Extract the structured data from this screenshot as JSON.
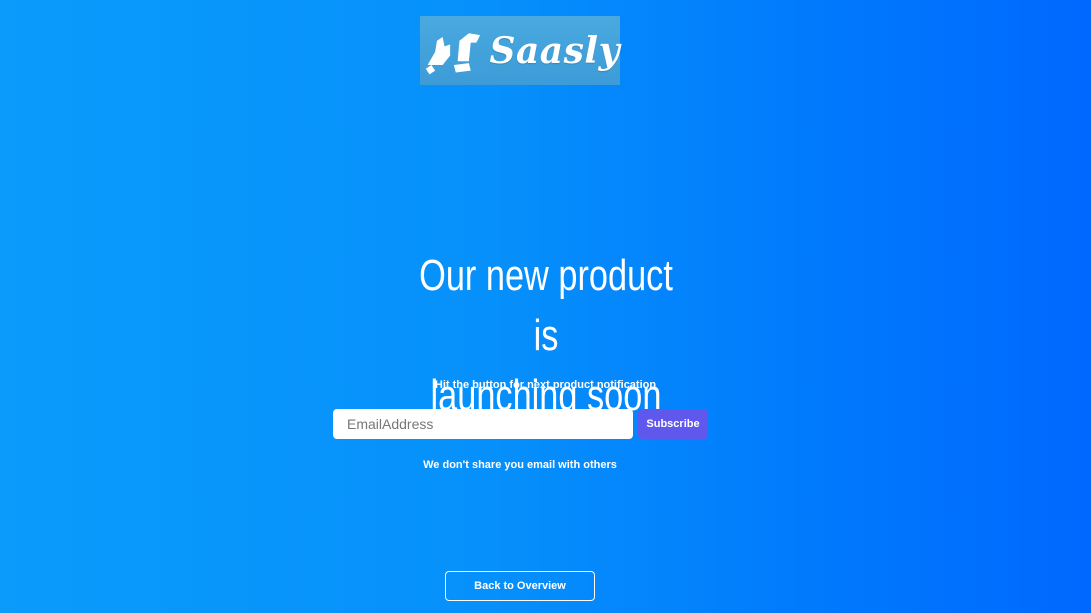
{
  "brand": {
    "logo_text": "Saasly",
    "logo_icon": "hands-logo-icon",
    "logo_bg_color": "#4aa9df"
  },
  "hero": {
    "headline_line1": "Our new product is",
    "headline_line2": "launching soon",
    "subtext": "Hit the button for next product notification"
  },
  "form": {
    "email_placeholder": "EmailAddress",
    "email_value": "",
    "subscribe_label": "Subscribe",
    "subscribe_color": "#6058ec"
  },
  "privacy_note": "We don't share you email with others",
  "back_label": "Back to Overview",
  "colors": {
    "background_start": "#0a9bfb",
    "background_end": "#0068fe",
    "text": "#ffffff"
  }
}
